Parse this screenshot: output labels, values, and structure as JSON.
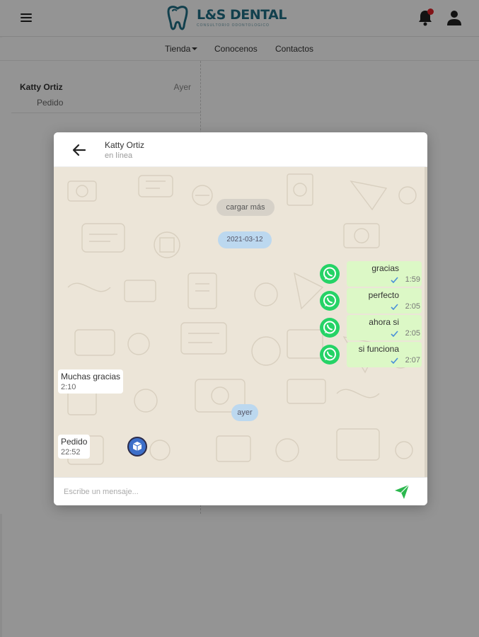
{
  "brand": {
    "logo_text": "L&S DENTAL",
    "logo_subtext": "CONSULTORIO ODONTOLOGICO"
  },
  "nav": {
    "items": [
      "Tienda",
      "Conocenos",
      "Contactos"
    ]
  },
  "sidebar": {
    "chat_item": {
      "name": "Katty Ortiz",
      "time": "Ayer",
      "last_message": "Pedido"
    }
  },
  "modal": {
    "contact_name": "Katty Ortiz",
    "contact_status": "en línea",
    "load_more": "cargar más",
    "date_separator": "2021-03-12",
    "day_separator": "ayer",
    "outgoing": [
      {
        "text": "gracias",
        "time": "1:59"
      },
      {
        "text": "perfecto",
        "time": "2:05"
      },
      {
        "text": "ahora si",
        "time": "2:05"
      },
      {
        "text": "si funciona",
        "time": "2:07"
      }
    ],
    "incoming": [
      {
        "text": "Muchas gracias",
        "time": "2:10"
      },
      {
        "text": "Pedido",
        "time": "22:52"
      }
    ],
    "input_placeholder": "Escribe un mensaje..."
  },
  "colors": {
    "brand": "#1f6e86",
    "whatsapp": "#25d366",
    "outgoing_bubble": "#dcf8c6",
    "notification_dot": "#e0242a",
    "send_icon": "#2bb84e"
  },
  "icons": [
    "menu-icon",
    "tooth-logo-icon",
    "bell-icon",
    "user-icon",
    "arrow-left-icon",
    "whatsapp-icon",
    "check-icon",
    "package-icon",
    "send-icon"
  ]
}
